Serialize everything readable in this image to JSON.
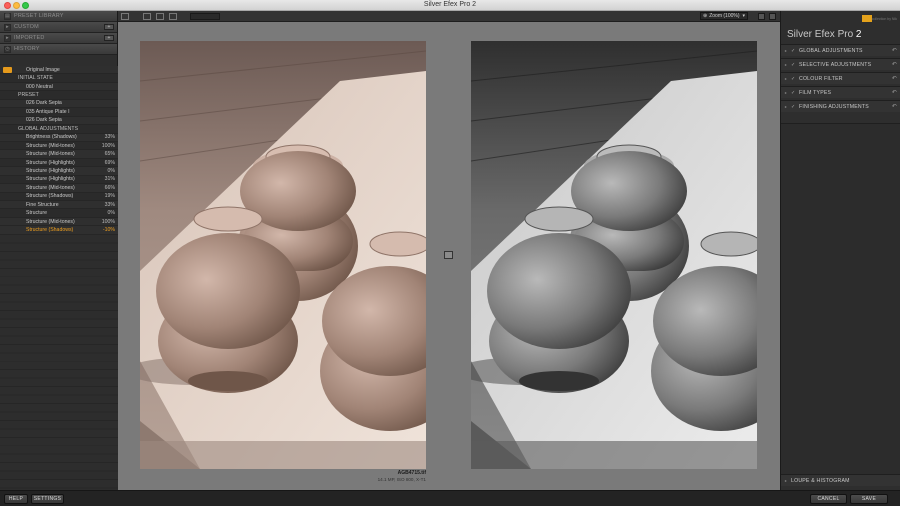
{
  "window": {
    "title": "Silver Efex Pro 2"
  },
  "left_panel": {
    "sections": [
      {
        "label": "PRESET LIBRARY"
      },
      {
        "label": "CUSTOM"
      },
      {
        "label": "IMPORTED"
      },
      {
        "label": "HISTORY"
      }
    ],
    "history": [
      {
        "label": "Original Image",
        "value": "",
        "kind": "item",
        "flag": true
      },
      {
        "label": "INITIAL STATE",
        "value": "",
        "kind": "cat"
      },
      {
        "label": "000 Neutral",
        "value": "",
        "kind": "item"
      },
      {
        "label": "PRESET",
        "value": "",
        "kind": "cat"
      },
      {
        "label": "026 Dark Sepia",
        "value": "",
        "kind": "item"
      },
      {
        "label": "035 Antique Plate I",
        "value": "",
        "kind": "item"
      },
      {
        "label": "026 Dark Sepia",
        "value": "",
        "kind": "item"
      },
      {
        "label": "GLOBAL ADJUSTMENTS",
        "value": "",
        "kind": "cat"
      },
      {
        "label": "Brightness (Shadows)",
        "value": "33%",
        "kind": "item"
      },
      {
        "label": "Structure (Mid-tones)",
        "value": "100%",
        "kind": "item"
      },
      {
        "label": "Structure (Mid-tones)",
        "value": "65%",
        "kind": "item"
      },
      {
        "label": "Structure (Highlights)",
        "value": "69%",
        "kind": "item"
      },
      {
        "label": "Structure (Highlights)",
        "value": "0%",
        "kind": "item"
      },
      {
        "label": "Structure (Highlights)",
        "value": "31%",
        "kind": "item"
      },
      {
        "label": "Structure (Mid-tones)",
        "value": "66%",
        "kind": "item"
      },
      {
        "label": "Structure (Shadows)",
        "value": "19%",
        "kind": "item"
      },
      {
        "label": "Fine Structure",
        "value": "33%",
        "kind": "item"
      },
      {
        "label": "Structure",
        "value": "0%",
        "kind": "item"
      },
      {
        "label": "Structure (Mid-tones)",
        "value": "100%",
        "kind": "item"
      },
      {
        "label": "Structure (Shadows)",
        "value": "-10%",
        "kind": "item",
        "active": true
      }
    ]
  },
  "toolbar": {
    "zoom_label": "Zoom (100%)"
  },
  "image": {
    "filename": "AGB4715.tif",
    "info": "14.1 MP, ISO 800, X-T1"
  },
  "right_panel": {
    "brand_title": "Silver Efex Pro",
    "brand_version": "2",
    "brand_sub": "collection by Nik",
    "sections": [
      {
        "label": "GLOBAL ADJUSTMENTS"
      },
      {
        "label": "SELECTIVE ADJUSTMENTS"
      },
      {
        "label": "COLOUR FILTER"
      },
      {
        "label": "FILM TYPES"
      },
      {
        "label": "FINISHING ADJUSTMENTS"
      }
    ],
    "loupe_label": "LOUPE & HISTOGRAM"
  },
  "bottom": {
    "help": "HELP",
    "settings": "SETTINGS",
    "cancel": "CANCEL",
    "save": "SAVE"
  },
  "colors": {
    "accent": "#f0a020",
    "canvas": "#7a7a7a"
  }
}
